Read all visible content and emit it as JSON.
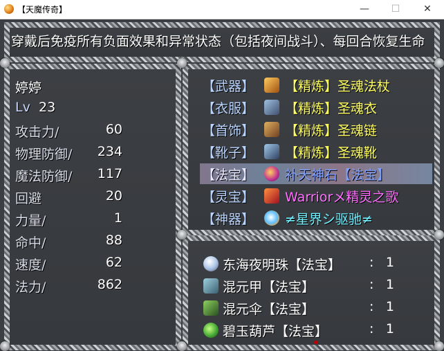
{
  "window": {
    "title": "【天魔传奇】",
    "minimize_glyph": "—",
    "maximize_glyph": "☐",
    "close_glyph": "✕"
  },
  "description": "穿戴后免疫所有负面效果和异常状态（包括夜间战斗）、每回合恢复生命",
  "character": {
    "name": "婷婷",
    "level_label": "Lv",
    "level": "23",
    "stats": [
      {
        "label": "攻击力/",
        "value": "60"
      },
      {
        "label": "物理防御/",
        "value": "234"
      },
      {
        "label": "魔法防御/",
        "value": "117"
      },
      {
        "label": "回避",
        "value": "20"
      },
      {
        "label": "力量/",
        "value": "1"
      },
      {
        "label": "命中/",
        "value": "88"
      },
      {
        "label": "速度/",
        "value": "62"
      },
      {
        "label": "法力/",
        "value": "862"
      }
    ]
  },
  "equipment": [
    {
      "slot": "【武器】",
      "item": "【精炼】圣魂法杖",
      "icon": "staff-icon",
      "color": "#ffff60"
    },
    {
      "slot": "【衣服】",
      "item": "【精炼】圣魂衣",
      "icon": "armor-icon",
      "color": "#ffff60"
    },
    {
      "slot": "【首饰】",
      "item": "【精炼】圣魂链",
      "icon": "necklace-icon",
      "color": "#ffff60"
    },
    {
      "slot": "【靴子】",
      "item": "【精炼】圣魂靴",
      "icon": "boots-icon",
      "color": "#ffff60"
    },
    {
      "slot": "【法宝】",
      "item": "补天神石【法宝】",
      "icon": "orb-icon",
      "color": "#80a0ff"
    },
    {
      "slot": "【灵宝】",
      "item": "Warriorメ精灵之歌",
      "icon": "wing-icon",
      "color": "#ff70ff"
    },
    {
      "slot": "【神器】",
      "item": "≠星界シ驱驰≠",
      "icon": "swirl-icon",
      "color": "#70f0ff"
    }
  ],
  "inventory": [
    {
      "name": "东海夜明珠【法宝】",
      "colon": ":",
      "qty": "1",
      "icon": "pearl-icon"
    },
    {
      "name": "混元甲【法宝】",
      "colon": ":",
      "qty": "1",
      "icon": "armor-piece-icon"
    },
    {
      "name": "混元伞【法宝】",
      "colon": ":",
      "qty": "1",
      "icon": "umbrella-icon"
    },
    {
      "name": "碧玉葫芦【法宝】",
      "colon": ":",
      "qty": "1",
      "icon": "gourd-icon"
    }
  ]
}
